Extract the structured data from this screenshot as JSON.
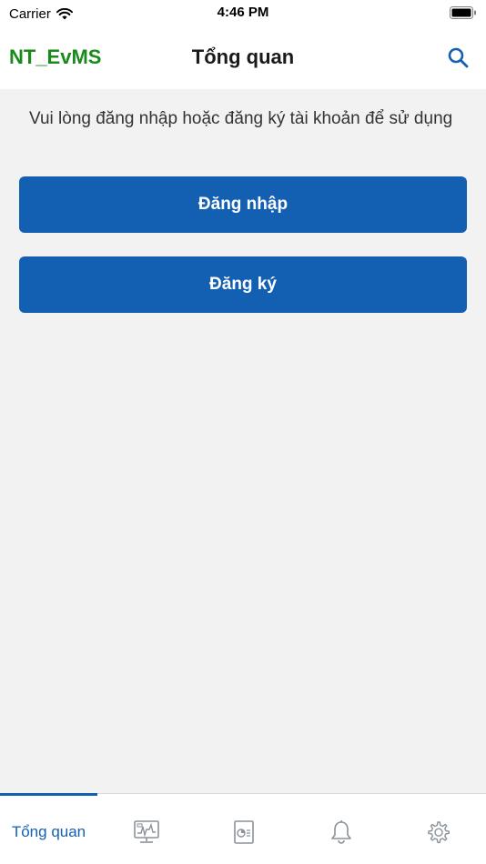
{
  "status_bar": {
    "carrier": "Carrier",
    "time": "4:46 PM"
  },
  "nav": {
    "brand": "NT_EvMS",
    "title": "Tổng quan"
  },
  "main": {
    "message": "Vui lòng đăng nhập hoặc đăng ký tài khoản để sử dụng",
    "login_label": "Đăng nhập",
    "register_label": "Đăng ký"
  },
  "tabs": [
    {
      "label": "Tổng quan",
      "icon": "home-tab",
      "active": true
    },
    {
      "label": "",
      "icon": "monitor-icon",
      "active": false
    },
    {
      "label": "",
      "icon": "report-icon",
      "active": false
    },
    {
      "label": "",
      "icon": "bell-icon",
      "active": false
    },
    {
      "label": "",
      "icon": "gear-icon",
      "active": false
    }
  ],
  "colors": {
    "brand_green": "#1a8a1a",
    "primary_blue": "#1360b3",
    "background": "#f2f2f2"
  }
}
